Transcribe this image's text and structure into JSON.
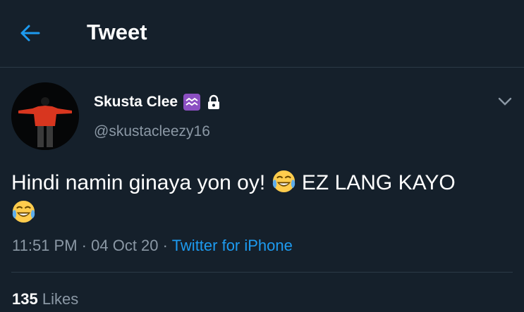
{
  "header": {
    "title": "Tweet"
  },
  "tweet": {
    "author_name": "Skusta Clee",
    "author_handle": "@skustacleezy16",
    "text_part1": "Hindi namin ginaya yon oy!",
    "text_part2": "EZ LANG KAYO",
    "emoji": "face-with-tears-of-joy",
    "badge_icon": "aquarius-icon",
    "time": "11:51 PM",
    "separator": "·",
    "date": "04 Oct 20",
    "source": "Twitter for iPhone",
    "likes_count": "135",
    "likes_label": "Likes"
  },
  "colors": {
    "background": "#15202b",
    "accent": "#1d9bf0",
    "secondary_text": "#8b98a5",
    "badge": "#8b4fc2"
  }
}
